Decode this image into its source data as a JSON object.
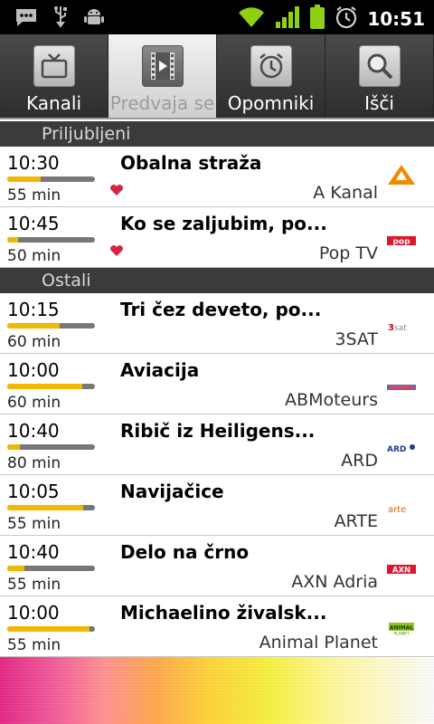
{
  "status": {
    "time": "10:51"
  },
  "tabs": [
    {
      "label": "Kanali",
      "icon": "tv-icon",
      "active": false
    },
    {
      "label": "Predvaja se",
      "icon": "film-icon",
      "active": true
    },
    {
      "label": "Opomniki",
      "icon": "alarm-clock-icon",
      "active": false
    },
    {
      "label": "Išči",
      "icon": "magnifier-icon",
      "active": false
    }
  ],
  "sections": [
    {
      "title": "Priljubljeni",
      "items": [
        {
          "time": "10:30",
          "duration": "55 min",
          "title": "Obalna straža",
          "channel": "A Kanal",
          "progress": 0.38,
          "favorite": true,
          "logo": "A"
        },
        {
          "time": "10:45",
          "duration": "50 min",
          "title": "Ko se zaljubim, po...",
          "channel": "Pop TV",
          "progress": 0.12,
          "favorite": true,
          "logo": "pop"
        }
      ]
    },
    {
      "title": "Ostali",
      "items": [
        {
          "time": "10:15",
          "duration": "60 min",
          "title": "Tri čez deveto, po...",
          "channel": "3SAT",
          "progress": 0.6,
          "favorite": false,
          "logo": "3sat"
        },
        {
          "time": "10:00",
          "duration": "60 min",
          "title": "Aviacija",
          "channel": "ABMoteurs",
          "progress": 0.86,
          "favorite": false,
          "logo": "ab"
        },
        {
          "time": "10:40",
          "duration": "80 min",
          "title": "Ribič iz Heiligens...",
          "channel": "ARD",
          "progress": 0.14,
          "favorite": false,
          "logo": "ARD"
        },
        {
          "time": "10:05",
          "duration": "55 min",
          "title": "Navijačice",
          "channel": "ARTE",
          "progress": 0.87,
          "favorite": false,
          "logo": "arte"
        },
        {
          "time": "10:40",
          "duration": "55 min",
          "title": "Delo na črno",
          "channel": "AXN Adria",
          "progress": 0.2,
          "favorite": false,
          "logo": "AXN"
        },
        {
          "time": "10:00",
          "duration": "55 min",
          "title": "Michaelino živalsk...",
          "channel": "Animal Planet",
          "progress": 0.94,
          "favorite": false,
          "logo": "animal"
        }
      ]
    }
  ],
  "colors": {
    "progress": "#f0b800",
    "heart": "#d8253f",
    "header": "#3b3b3b"
  }
}
